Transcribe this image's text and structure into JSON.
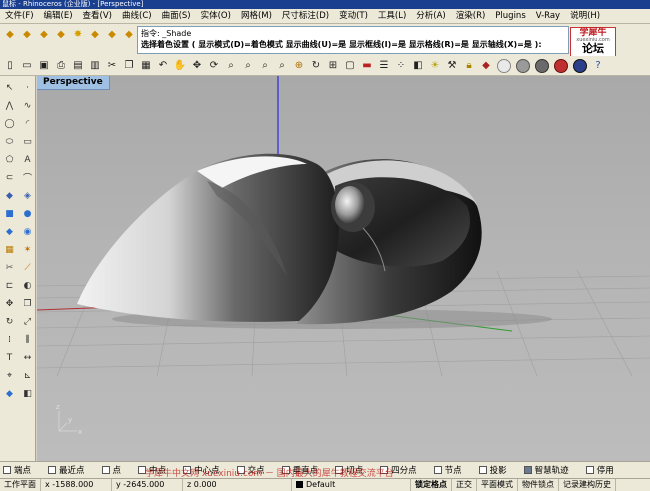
{
  "window": {
    "title": "鼠标 - Rhinoceros (企业版) - [Perspective]"
  },
  "menu": [
    {
      "label": "文件(F)"
    },
    {
      "label": "编辑(E)"
    },
    {
      "label": "查看(V)"
    },
    {
      "label": "曲线(C)"
    },
    {
      "label": "曲面(S)"
    },
    {
      "label": "实体(O)"
    },
    {
      "label": "网格(M)"
    },
    {
      "label": "尺寸标注(D)"
    },
    {
      "label": "变动(T)"
    },
    {
      "label": "工具(L)"
    },
    {
      "label": "分析(A)"
    },
    {
      "label": "渲染(R)"
    },
    {
      "label": "Plugins"
    },
    {
      "label": "V-Ray"
    },
    {
      "label": "说明(H)"
    }
  ],
  "command": {
    "history": "指令: _Shade",
    "prompt": "选择着色设置 ( 显示模式(D)=着色模式  显示曲线(U)=是  显示框线(I)=是  显示格线(R)=是  显示轴线(X)=是 ): "
  },
  "logo": {
    "top": "学犀牛",
    "url": "xuexiniu.com",
    "main": "论坛"
  },
  "viewport": {
    "label": "Perspective",
    "axis_x": "x",
    "axis_y": "y",
    "axis_z": "z"
  },
  "osnap": [
    {
      "label": "端点",
      "checked": false
    },
    {
      "label": "最近点",
      "checked": false
    },
    {
      "label": "点",
      "checked": false
    },
    {
      "label": "中点",
      "checked": false
    },
    {
      "label": "中心点",
      "checked": false
    },
    {
      "label": "交点",
      "checked": false
    },
    {
      "label": "垂直点",
      "checked": false
    },
    {
      "label": "切点",
      "checked": false
    },
    {
      "label": "四分点",
      "checked": false
    },
    {
      "label": "节点",
      "checked": false
    },
    {
      "label": "投影",
      "checked": false
    },
    {
      "label": "智慧轨迹",
      "checked": true
    },
    {
      "label": "停用",
      "checked": false
    }
  ],
  "status": {
    "cplane": "工作平面",
    "x": "x -1588.000",
    "y": "y -2645.000",
    "z": "z 0.000",
    "layer": "Default",
    "gridsnap": "锁定格点",
    "ortho": "正交",
    "planar": "平面模式",
    "osnap": "物件锁点",
    "history": "记录建构历史"
  },
  "watermark": "学犀牛中文网 xuexiniu.com － 国内最大的犀牛教程交流平台",
  "colors": {
    "viewport_label": "#9fbfe3",
    "z_axis": "#2a2ae0",
    "x_axis": "#b03030",
    "y_axis": "#2f9a2f"
  }
}
